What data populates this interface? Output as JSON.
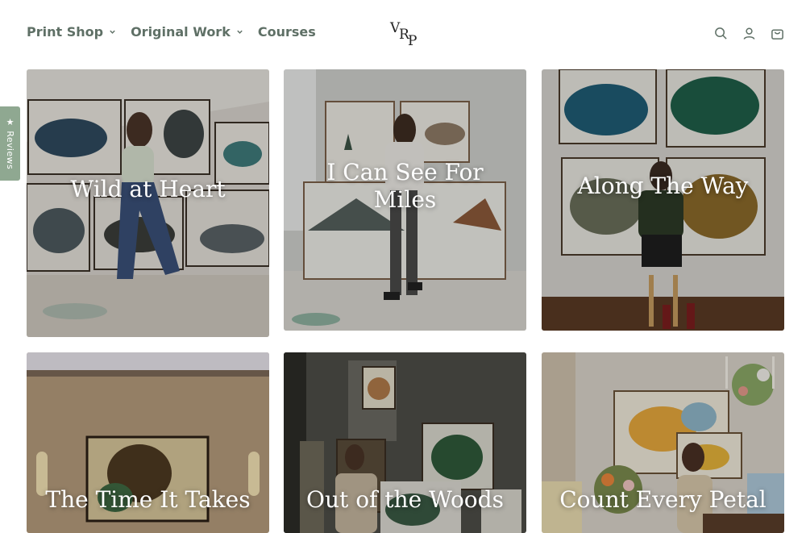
{
  "header": {
    "nav": [
      {
        "label": "Print Shop",
        "has_dropdown": true
      },
      {
        "label": "Original Work",
        "has_dropdown": true
      },
      {
        "label": "Courses",
        "has_dropdown": false
      }
    ],
    "logo_text": "VRP",
    "icons": [
      "search-icon",
      "account-icon",
      "cart-icon"
    ]
  },
  "reviews_tab": {
    "label": "★ Reviews"
  },
  "collections": [
    {
      "title": "Wild at Heart"
    },
    {
      "title": "I Can See For Miles"
    },
    {
      "title": "Along The Way"
    },
    {
      "title": "The Time It Takes"
    },
    {
      "title": "Out of the Woods"
    },
    {
      "title": "Count Every Petal"
    }
  ],
  "colors": {
    "nav_text": "#5f7066",
    "reviews_bg": "#8fa891"
  }
}
